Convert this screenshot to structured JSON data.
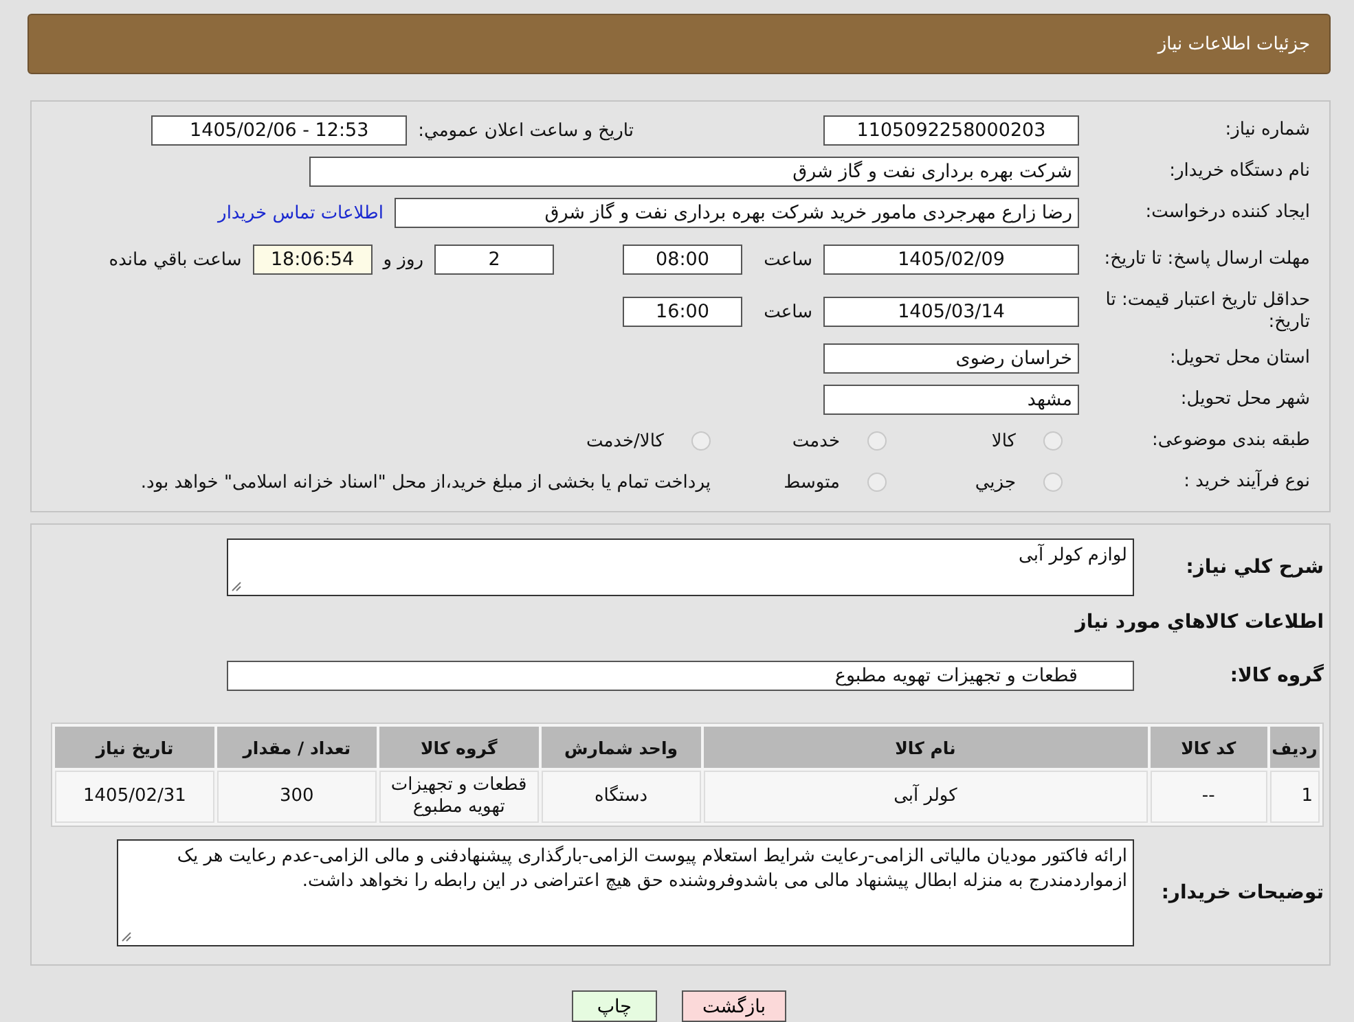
{
  "header": {
    "title": "جزئیات اطلاعات نیاز"
  },
  "details": {
    "need_number": {
      "label": "شماره نیاز:",
      "value": "1105092258000203"
    },
    "announce": {
      "label": "تاريخ و ساعت اعلان عمومي:",
      "value": "1405/02/06 - 12:53"
    },
    "buyer_org": {
      "label": "نام دستگاه خریدار:",
      "value": "شرکت بهره برداری نفت و گاز شرق"
    },
    "creator": {
      "label": "ایجاد کننده درخواست:",
      "value": "رضا زارع مهرجردی مامور خرید شرکت بهره برداری نفت و گاز شرق",
      "link": "اطلاعات تماس خریدار"
    },
    "deadline": {
      "label": "مهلت ارسال پاسخ: تا تاریخ:",
      "date": "1405/02/09",
      "time_label": "ساعت",
      "time": "08:00",
      "days": "2",
      "days_label": "روز و",
      "remaining": "18:06:54",
      "remaining_label": "ساعت باقي مانده"
    },
    "validity": {
      "label": "حداقل تاریخ اعتبار قیمت: تا تاریخ:",
      "date": "1405/03/14",
      "time_label": "ساعت",
      "time": "16:00"
    },
    "province": {
      "label": "استان محل تحویل:",
      "value": "خراسان رضوی"
    },
    "city": {
      "label": "شهر محل تحویل:",
      "value": "مشهد"
    },
    "category": {
      "label": "طبقه بندی موضوعی:",
      "options": [
        {
          "label": "کالا",
          "selected": false
        },
        {
          "label": "خدمت",
          "selected": false
        },
        {
          "label": "کالا/خدمت",
          "selected": false
        }
      ]
    },
    "process": {
      "label": "نوع فرآیند خرید :",
      "options": [
        {
          "label": "جزيي",
          "selected": false
        },
        {
          "label": "متوسط",
          "selected": false
        }
      ],
      "note": "پرداخت تمام یا بخشی از مبلغ خرید،از محل \"اسناد خزانه اسلامی\" خواهد بود."
    }
  },
  "goods": {
    "description": {
      "label": "شرح کلي نیاز:",
      "value": "لوازم کولر آبی"
    },
    "section_title": "اطلاعات کالاهاي مورد نیاز",
    "group": {
      "label": "گروه کالا:",
      "value": "قطعات و تجهیزات تهویه مطبوع"
    },
    "table": {
      "columns": [
        "ردیف",
        "کد کالا",
        "نام کالا",
        "واحد شمارش",
        "گروه کالا",
        "تعداد / مقدار",
        "تاریخ نیاز"
      ],
      "rows": [
        [
          "1",
          "--",
          "کولر آبی",
          "دستگاه",
          "قطعات و تجهیزات تهویه مطبوع",
          "300",
          "1405/02/31"
        ]
      ]
    },
    "buyer_notes": {
      "label": "توضیحات خریدار:",
      "value": "ارائه فاکتور مودیان مالیاتی الزامی-رعایت شرایط استعلام پیوست الزامی-بارگذاری پیشنهادفنی و مالی الزامی-عدم رعایت هر یک ازمواردمندرج به منزله ابطال پیشنهاد مالی می باشدوفروشنده حق هیچ اعتراضی در این رابطه را نخواهد داشت."
    }
  },
  "buttons": [
    {
      "kind": "back",
      "label": "بازگشت"
    },
    {
      "kind": "print",
      "label": "چاپ"
    }
  ]
}
